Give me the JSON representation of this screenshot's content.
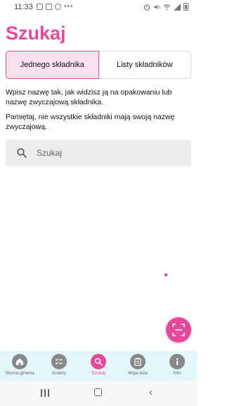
{
  "status": {
    "time": "11:33",
    "dots": "•••"
  },
  "page_title": "Szukaj",
  "tabs": [
    {
      "label": "Jednego składnika",
      "active": true
    },
    {
      "label": "Listy składników",
      "active": false
    }
  ],
  "instructions": {
    "p1": "Wpisz nazwę tak, jak widzisz ją na opakowaniu lub nazwę zwyczajową składnika.",
    "p2": "Pamiętaj, nie wszystkie składniki mają swoją nazwę zwyczajową."
  },
  "search": {
    "placeholder": "Szukaj",
    "value": ""
  },
  "fab": {
    "icon": "scan-icon"
  },
  "bottom_nav": [
    {
      "label": "Strona główna",
      "icon": "home-icon",
      "active": false
    },
    {
      "label": "Analizy",
      "icon": "checklist-icon",
      "active": false
    },
    {
      "label": "Szukaj",
      "icon": "search-icon",
      "active": true
    },
    {
      "label": "Moja lista",
      "icon": "clipboard-icon",
      "active": false
    },
    {
      "label": "Info",
      "icon": "info-icon",
      "active": false
    }
  ],
  "colors": {
    "accent": "#e8489a",
    "tab_active_bg": "#fbe0ee",
    "nav_bg": "#e2f6fb",
    "search_bg": "#ececec"
  }
}
